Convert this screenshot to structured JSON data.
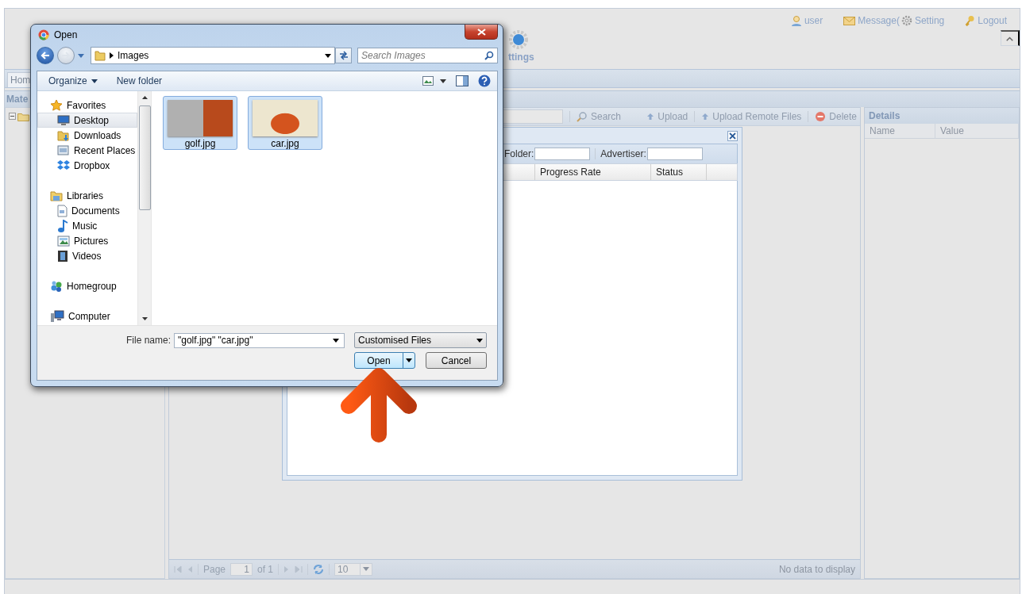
{
  "app": {
    "header": {
      "nav_label": "ttings",
      "links": [
        {
          "label": "user",
          "kind": "user"
        },
        {
          "label": "Message(",
          "kind": "message"
        },
        {
          "label": "Setting",
          "kind": "setting"
        },
        {
          "label": "Logout",
          "kind": "logout"
        }
      ]
    },
    "tabs": [
      {
        "label": "Hom",
        "selected": true
      }
    ],
    "panel_title": "Mate",
    "toolbar": {
      "search": "Search",
      "actions": [
        {
          "label": "Upload",
          "kind": "upload"
        },
        {
          "label": "Upload Remote Files",
          "kind": "upload"
        },
        {
          "label": "Delete",
          "kind": "delete"
        }
      ]
    },
    "paging": {
      "page_label": "Page",
      "page": "1",
      "of": "of 1",
      "page_size": "10",
      "status": "No data to display"
    },
    "details": {
      "title": "Details",
      "columns": [
        "Name",
        "Value"
      ]
    }
  },
  "upload_window": {
    "filters": [
      {
        "label": "Folder:"
      },
      {
        "label": "Advertiser:"
      }
    ],
    "columns": [
      "Progress Rate",
      "Status"
    ]
  },
  "open_dialog": {
    "title": "Open",
    "folder": "Images",
    "search": {
      "placeholder": "Search Images"
    },
    "commands": [
      "Organize",
      "New folder"
    ],
    "nav": [
      {
        "label": "Favorites",
        "kind": "favorites",
        "selected": false,
        "children": [
          {
            "label": "Desktop",
            "kind": "desktop",
            "selected": true
          },
          {
            "label": "Downloads",
            "kind": "downloads",
            "selected": false
          },
          {
            "label": "Recent Places",
            "kind": "places",
            "selected": false
          },
          {
            "label": "Dropbox",
            "kind": "dropbox",
            "selected": false
          }
        ]
      },
      {
        "label": "Libraries",
        "kind": "libraries",
        "selected": false,
        "children": [
          {
            "label": "Documents",
            "kind": "documents",
            "selected": false
          },
          {
            "label": "Music",
            "kind": "music",
            "selected": false
          },
          {
            "label": "Pictures",
            "kind": "pictures",
            "selected": false
          },
          {
            "label": "Videos",
            "kind": "videos",
            "selected": false
          }
        ]
      },
      {
        "label": "Homegroup",
        "kind": "homegroup",
        "selected": false
      },
      {
        "label": "Computer",
        "kind": "computer",
        "selected": false
      }
    ],
    "files": [
      {
        "name": "golf.jpg",
        "selected": true
      },
      {
        "name": "car.jpg",
        "selected": true
      }
    ],
    "file_name_label": "File name:",
    "file_name": "\"golf.jpg\" \"car.jpg\"",
    "filter": "Customised Files",
    "buttons": [
      {
        "label": "Open",
        "kind": "split"
      },
      {
        "label": "Cancel",
        "kind": "plain"
      }
    ]
  }
}
